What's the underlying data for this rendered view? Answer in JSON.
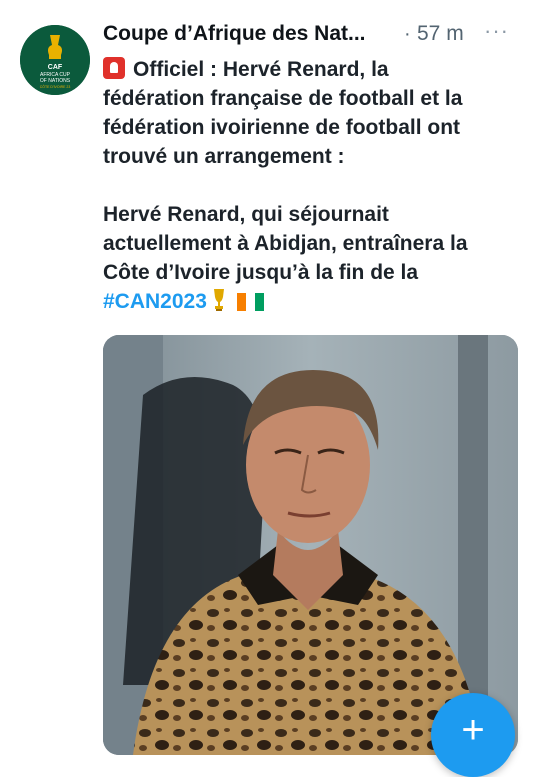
{
  "tweet": {
    "author": "Coupe d’Afrique des Nat...",
    "separator": "·",
    "time": "57 m",
    "more": "···",
    "line1": "Officiel : Hervé Renard, la",
    "line2": "fédération française de football et la",
    "line3": "fédération ivoirienne de football ont",
    "line4": "trouvé un arrangement :",
    "line5": "Hervé Renard, qui séjournait",
    "line6": "actuellement à Abidjan, entraînera la",
    "line7": "Côte d’Ivoire jusqu’à la fin de la",
    "hashtag": "#CAN2023"
  },
  "avatar": {
    "line1": "CAF",
    "line2": "AFRICA CUP",
    "line3": "OF NATIONS",
    "line4": "CÔTE D'IVOIRE 23"
  },
  "fab": {
    "label": "+"
  },
  "colors": {
    "accent": "#1d9bf0",
    "avatar_bg": "#0b5a3c",
    "siren": "#e0312b"
  },
  "icons": {
    "siren": "police-light-icon",
    "trophy": "trophy-icon",
    "flag": "ivory-coast-flag-icon",
    "more": "more-horizontal-icon",
    "compose": "compose-plus-icon"
  }
}
